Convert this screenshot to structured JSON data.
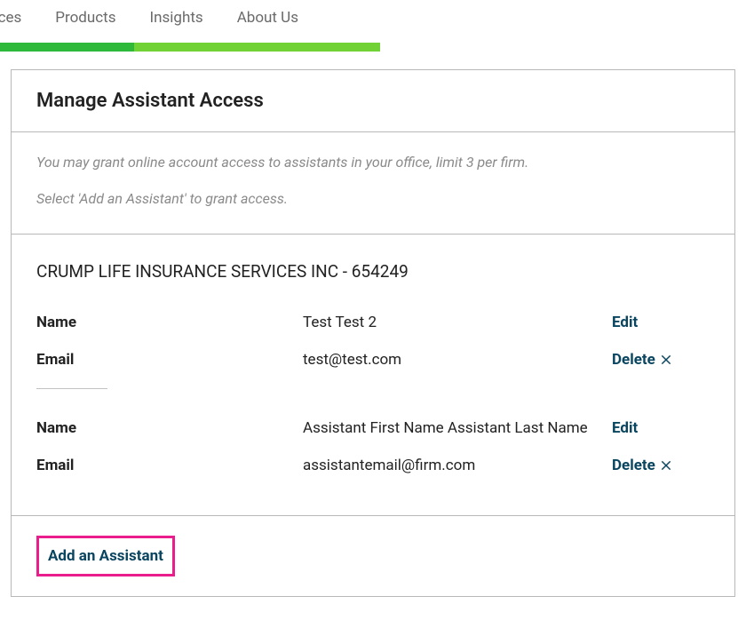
{
  "nav": {
    "items": [
      "rces",
      "Products",
      "Insights",
      "About Us"
    ]
  },
  "progress": {
    "seg1_color": "#2fb93b",
    "seg1_width_pct": 18,
    "seg2_color": "#71d236",
    "seg2_width_pct": 33
  },
  "page": {
    "title": "Manage Assistant Access",
    "intro_line1": "You may grant online account access to assistants in your office, limit 3 per firm.",
    "intro_line2": "Select 'Add an Assistant' to grant access."
  },
  "firm": {
    "display_name": "CRUMP LIFE INSURANCE SERVICES INC - 654249",
    "labels": {
      "name": "Name",
      "email": "Email",
      "edit": "Edit",
      "delete": "Delete"
    },
    "assistants": [
      {
        "name": "Test Test 2",
        "email": "test@test.com"
      },
      {
        "name": "Assistant First Name Assistant Last Name",
        "email": "assistantemail@firm.com"
      }
    ]
  },
  "actions": {
    "add_assistant": "Add an Assistant"
  },
  "colors": {
    "link": "#0a4560",
    "highlight_border": "#e91e8c"
  }
}
